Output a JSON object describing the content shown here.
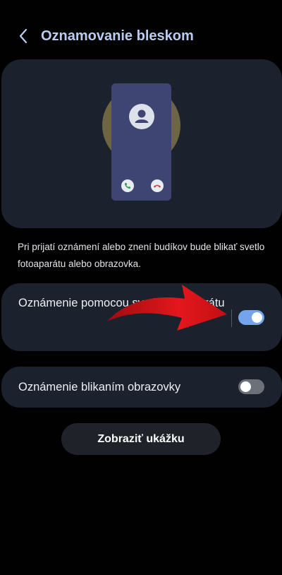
{
  "header": {
    "title": "Oznamovanie bleskom",
    "back_icon": "chevron-left-icon"
  },
  "illustration": {
    "glow_color": "#6e6642",
    "phone_color": "#3e4573",
    "icons": [
      "person-icon",
      "accept-call-icon",
      "decline-call-icon"
    ]
  },
  "description": "Pri prijatí oznámení alebo znení budíkov bude blikať svetlo fotoaparátu alebo obrazovka.",
  "settings": {
    "camera_flash": {
      "label": "Oznámenie pomocou svetla fotoaparátu",
      "enabled": true
    },
    "screen_flash": {
      "label": "Oznámenie blikaním obrazovky",
      "enabled": false
    }
  },
  "preview_button": "Zobraziť ukážku",
  "colors": {
    "accent": "#74a4ec",
    "title": "#b9cdf2",
    "card_bg": "#1b222d",
    "annotation_arrow": "#e4171c"
  }
}
